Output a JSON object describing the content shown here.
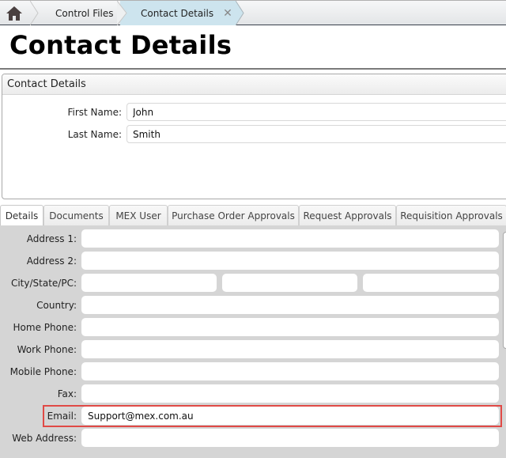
{
  "breadcrumb": {
    "home_icon": "home-icon",
    "items": [
      {
        "label": "Control Files"
      },
      {
        "label": "Contact Details",
        "active": true,
        "close_icon": "close-icon"
      }
    ]
  },
  "page": {
    "title": "Contact Details"
  },
  "contact_panel": {
    "header": "Contact Details",
    "fields": {
      "first_name": {
        "label": "First Name:",
        "value": "John"
      },
      "last_name": {
        "label": "Last Name:",
        "value": "Smith"
      }
    }
  },
  "tabs": [
    {
      "label": "Details",
      "active": true
    },
    {
      "label": "Documents"
    },
    {
      "label": "MEX User"
    },
    {
      "label": "Purchase Order Approvals"
    },
    {
      "label": "Request Approvals"
    },
    {
      "label": "Requisition Approvals"
    }
  ],
  "details": {
    "address1": {
      "label": "Address 1:",
      "value": ""
    },
    "address2": {
      "label": "Address 2:",
      "value": ""
    },
    "city_state_pc": {
      "label": "City/State/PC:",
      "city": "",
      "state": "",
      "postcode": ""
    },
    "country": {
      "label": "Country:",
      "value": ""
    },
    "home_phone": {
      "label": "Home Phone:",
      "value": ""
    },
    "work_phone": {
      "label": "Work Phone:",
      "value": ""
    },
    "mobile_phone": {
      "label": "Mobile Phone:",
      "value": ""
    },
    "fax": {
      "label": "Fax:",
      "value": ""
    },
    "email": {
      "label": "Email:",
      "value": "Support@mex.com.au",
      "highlighted": true
    },
    "web_address": {
      "label": "Web Address:",
      "value": ""
    }
  },
  "colors": {
    "active_breadcrumb": "#cde4ee",
    "highlight_border": "#e04a46",
    "details_background": "#d5d5d5"
  }
}
